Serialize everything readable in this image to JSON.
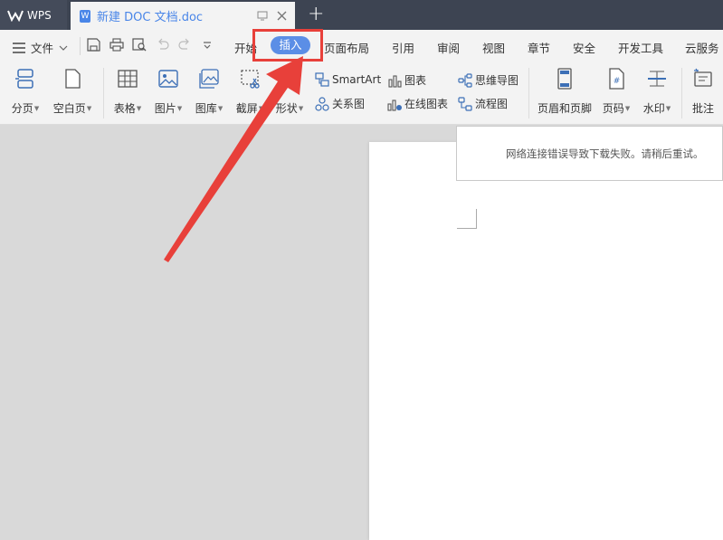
{
  "titlebar": {
    "app_tab_label": "WPS",
    "doc_tab_title": "新建 DOC 文档.doc",
    "new_tab_symbol": "+"
  },
  "menubar": {
    "file_label": "文件",
    "tabs": [
      "开始",
      "插入",
      "页面布局",
      "引用",
      "审阅",
      "视图",
      "章节",
      "安全",
      "开发工具",
      "云服务"
    ],
    "active_tab": "插入"
  },
  "ribbon": {
    "page_break": "分页",
    "blank_page": "空白页",
    "table": "表格",
    "picture": "图片",
    "gallery": "图库",
    "screenshot": "截屏",
    "shape": "形状",
    "smartart": "SmartArt",
    "relation_chart": "关系图",
    "chart": "图表",
    "online_chart": "在线图表",
    "mind_map": "思维导图",
    "flow_chart": "流程图",
    "header_footer": "页眉和页脚",
    "page_number": "页码",
    "watermark": "水印",
    "comment": "批注"
  },
  "notification": {
    "message": "网络连接错误导致下载失败。请稍后重试。"
  },
  "colors": {
    "titlebar_bg": "#3d4452",
    "accent_blue": "#5b8ee6",
    "annotation_red": "#e8403a"
  },
  "icons": [
    "wps-logo-icon",
    "doc-file-icon",
    "restore-icon",
    "close-icon",
    "add-tab-icon",
    "menu-icon",
    "save-icon",
    "print-icon",
    "print-preview-icon",
    "undo-icon",
    "redo-icon",
    "more-icon"
  ]
}
